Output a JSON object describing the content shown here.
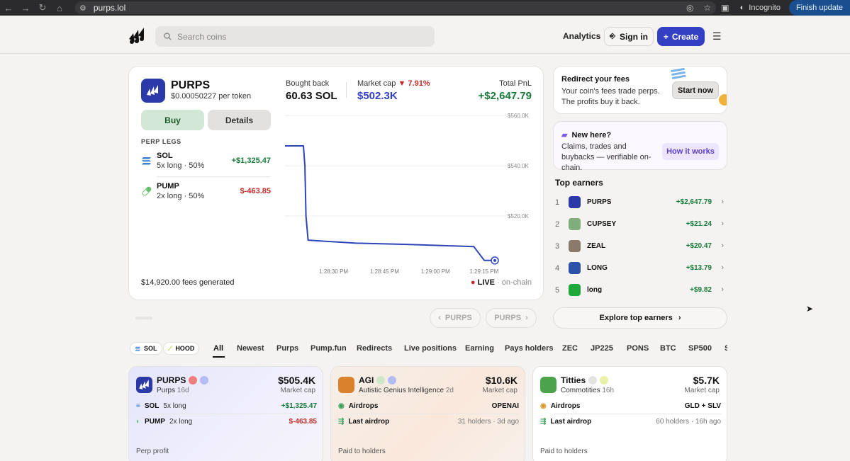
{
  "browser": {
    "url": "purps.lol",
    "incognito_label": "Incognito",
    "finish_update_label": "Finish update"
  },
  "header": {
    "search_placeholder": "Search coins",
    "analytics_label": "Analytics",
    "signin_label": "Sign in",
    "create_label": "Create"
  },
  "token": {
    "name": "PURPS",
    "price": "$0.00050227 per token",
    "bought_back_label": "Bought back",
    "bought_back_value": "60.63 SOL",
    "market_cap_label": "Market cap",
    "market_cap_change": "7.91%",
    "market_cap_value": "$502.3K",
    "total_pnl_label": "Total PnL",
    "total_pnl_value": "+$2,647.79",
    "buy_label": "Buy",
    "details_label": "Details",
    "perp_legs_title": "PERP LEGS",
    "legs": [
      {
        "name": "SOL",
        "desc": "5x long · 50%",
        "value": "+$1,325.47",
        "sign": "pos"
      },
      {
        "name": "PUMP",
        "desc": "2x long · 50%",
        "value": "$-463.85",
        "sign": "neg"
      }
    ],
    "fees": "$14,920.00 fees generated",
    "live_label": "LIVE",
    "onchain_label": "· on-chain"
  },
  "chart_data": {
    "type": "line",
    "yticks": [
      "$560.0K",
      "$540.0K",
      "$520.0K"
    ],
    "ytick_values": [
      560000,
      540000,
      520000
    ],
    "xticks": [
      "1:28:30 PM",
      "1:28:45 PM",
      "1:29:00 PM",
      "1:29:15 PM"
    ],
    "ylim": [
      500000,
      562000
    ],
    "series": [
      {
        "x": [
          0,
          0.088,
          0.095,
          0.1,
          0.11,
          0.18,
          0.34,
          0.58,
          0.76,
          0.9,
          0.95,
          1.0
        ],
        "values": [
          547900,
          547900,
          540000,
          520000,
          510400,
          510000,
          509200,
          508700,
          508200,
          507800,
          502300,
          502300
        ]
      }
    ],
    "color": "#2d45b8"
  },
  "promo": {
    "title": "Redirect your fees",
    "desc": "Your coin's fees trade perps. The profits buy it back.",
    "button": "Start now"
  },
  "newhere": {
    "title": "New here?",
    "desc": "Claims, trades and buybacks — verifiable on-chain.",
    "button": "How it works"
  },
  "top_earners": {
    "title": "Top earners",
    "rows": [
      {
        "rank": "1",
        "name": "PURPS",
        "value": "+$2,647.79",
        "color": "#2c3aa8"
      },
      {
        "rank": "2",
        "name": "CUPSEY",
        "value": "+$21.24",
        "color": "#7fae7a"
      },
      {
        "rank": "3",
        "name": "ZEAL",
        "value": "+$20.47",
        "color": "#8a7a6a"
      },
      {
        "rank": "4",
        "name": "LONG",
        "value": "+$13.79",
        "color": "#2b52a8"
      },
      {
        "rank": "5",
        "name": "long",
        "value": "+$9.82",
        "color": "#1ea83a"
      }
    ],
    "explore_label": "Explore top earners"
  },
  "pager": {
    "prev": "PURPS",
    "next": "PURPS"
  },
  "filters": {
    "chips": [
      "SOL",
      "HOOD"
    ],
    "tabs": [
      "All",
      "Newest",
      "Purps",
      "Pump.fun",
      "Redirects",
      "Live positions",
      "Earning",
      "Pays holders",
      "ZEC",
      "JP225",
      "PONS",
      "BTC",
      "SP500",
      "S"
    ]
  },
  "cards": [
    {
      "name": "PURPS",
      "sub": "Purps",
      "age": "16d",
      "mc": "$505.4K",
      "mc_label": "Market cap",
      "row1_label": "SOL",
      "row1_desc": "5x long",
      "row1_value": "+$1,325.47",
      "row2_label": "PUMP",
      "row2_desc": "2x long",
      "row2_value": "$-463.85",
      "foot": "Perp profit"
    },
    {
      "name": "AGI",
      "sub": "Autistic Genius Intelligence",
      "age": "2d",
      "mc": "$10.6K",
      "mc_label": "Market cap",
      "row1_label": "Airdrops",
      "row1_value": "OPENAI",
      "row2_label": "Last airdrop",
      "row2_value": "31 holders · 3d ago",
      "foot": "Paid to holders"
    },
    {
      "name": "Titties",
      "sub": "Commotities",
      "age": "16h",
      "mc": "$5.7K",
      "mc_label": "Market cap",
      "row1_label": "Airdrops",
      "row1_value": "GLD + SLV",
      "row2_label": "Last airdrop",
      "row2_value": "60 holders · 16h ago",
      "foot": "Paid to holders"
    }
  ]
}
